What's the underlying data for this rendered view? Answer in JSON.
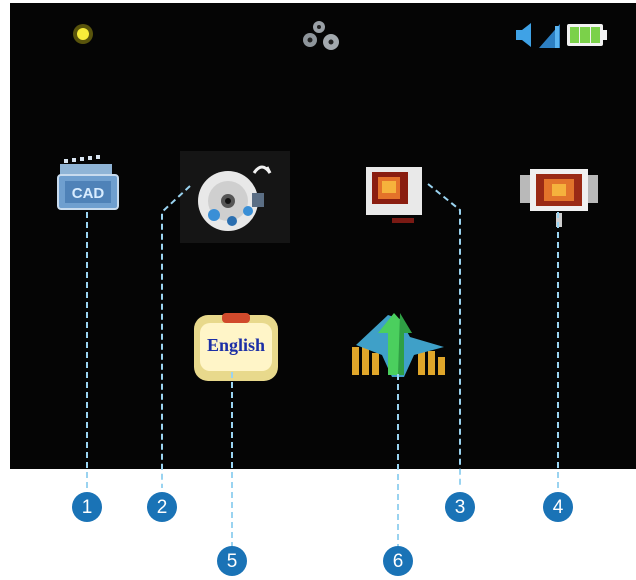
{
  "colors": {
    "screen_bg": "#050505",
    "callout": "#1a73b6",
    "leader": "#9ad3f0",
    "battery": "#7bd14a",
    "volume": "#3fa2e6",
    "brightness": "#f5e71a"
  },
  "status_bar": {
    "brightness_icon": "sun-icon",
    "settings_icon": "gears-icon",
    "volume_icon": "speaker-icon",
    "signal_icon": "signal-bars-icon",
    "battery_icon": "battery-icon"
  },
  "menu": {
    "items": [
      {
        "id": 1,
        "icon": "clapperboard-icon"
      },
      {
        "id": 2,
        "icon": "disc-music-icon"
      },
      {
        "id": 3,
        "icon": "photo-frame-icon"
      },
      {
        "id": 4,
        "icon": "slideshow-icon"
      },
      {
        "id": 5,
        "icon": "language-icon",
        "label": "English"
      },
      {
        "id": 6,
        "icon": "equalizer-icon"
      }
    ]
  },
  "callouts": [
    "1",
    "2",
    "3",
    "4",
    "5",
    "6"
  ]
}
